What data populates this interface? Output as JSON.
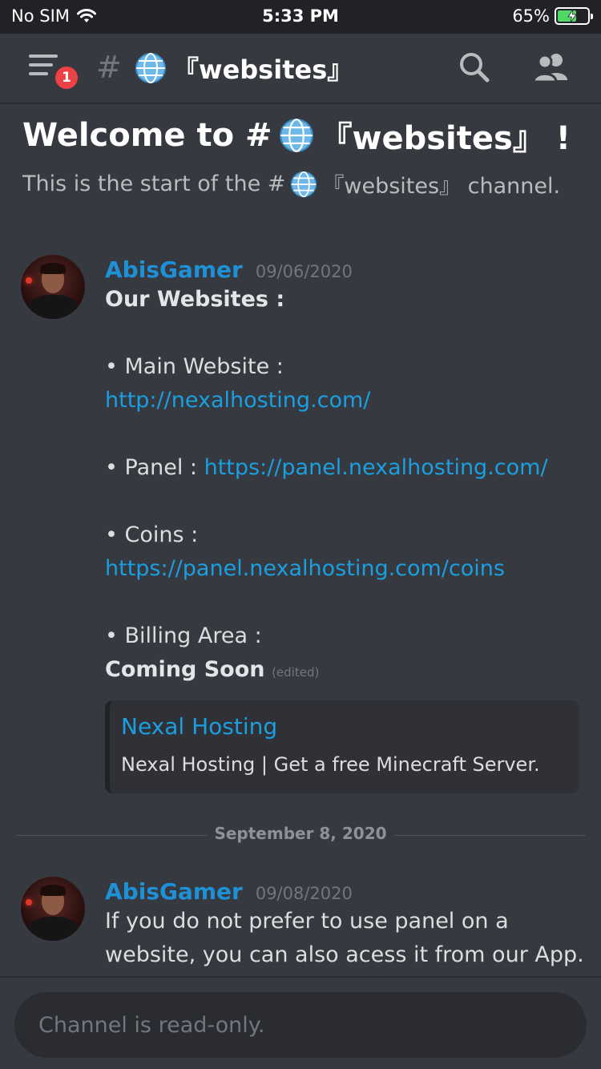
{
  "status_bar": {
    "carrier": "No SIM",
    "time": "5:33 PM",
    "battery": "65%",
    "battery_level": 0.65
  },
  "header": {
    "notification_count": "1",
    "channel_hash": "#",
    "channel_name": "『websites』"
  },
  "welcome": {
    "title_prefix": "Welcome to #",
    "title_channel": "『websites』 !",
    "subtitle_prefix": "This is the start of the #",
    "subtitle_suffix": "『websites』 channel."
  },
  "messages": [
    {
      "username": "AbisGamer",
      "timestamp": "09/06/2020",
      "lines": {
        "heading": "Our Websites :",
        "main_label": "• Main Website :",
        "main_url": "http://nexalhosting.com/",
        "panel_label": "• Panel : ",
        "panel_url": "https://panel.nexalhosting.com/",
        "coins_label": "• Coins :",
        "coins_url": "https://panel.nexalhosting.com/coins",
        "billing_label": "• Billing Area :",
        "billing_value": "Coming Soon",
        "edited": "(edited)"
      },
      "embed": {
        "title": "Nexal Hosting",
        "description": "Nexal Hosting | Get a free Minecraft Server."
      }
    },
    {
      "username": "AbisGamer",
      "timestamp": "09/08/2020",
      "lines": {
        "line1": "If you do not prefer to use panel on a",
        "line2": "website, you can also acess it from our App."
      }
    }
  ],
  "date_divider": "September 8, 2020",
  "input": {
    "placeholder": "Channel is read-only."
  },
  "colors": {
    "background": "#36393f",
    "username": "#1e90d6",
    "link": "#1a9fe0",
    "badge": "#ed4245"
  }
}
